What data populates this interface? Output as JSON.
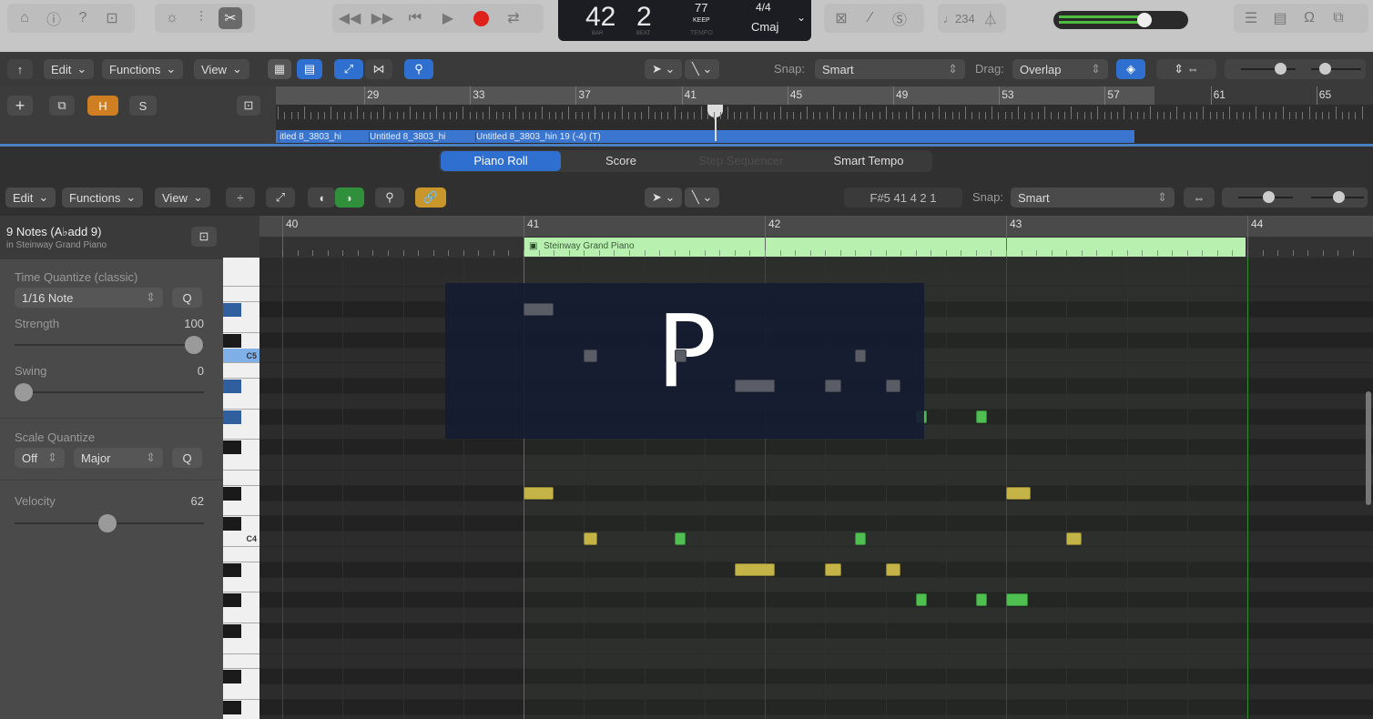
{
  "control_bar": {
    "lcd": {
      "bar": "42",
      "beat": "2",
      "bar_label": "BAR",
      "beat_label": "BEAT",
      "tempo": "77",
      "tempo_mode": "KEEP",
      "tempo_label": "TEMPO",
      "time_signature": "4/4",
      "key": "Cmaj"
    },
    "count_in": "♩234",
    "master_volume": 0.75,
    "icons": [
      "inbox-icon",
      "info-icon",
      "help-icon",
      "download-icon",
      "brightness-icon",
      "mixer-icon",
      "scissors-icon",
      "rewind-icon",
      "fast-forward-icon",
      "go-to-start-icon",
      "play-icon",
      "record-icon",
      "cycle-icon",
      "tuner-icon",
      "pencil-icon",
      "solo-icon",
      "metronome-icon",
      "list-icon",
      "note-pad-icon",
      "loops-icon",
      "browser-icon"
    ],
    "record_color": "#e0201a"
  },
  "tracks_toolbar": {
    "edit": "Edit",
    "functions": "Functions",
    "view": "View",
    "snap_label": "Snap:",
    "snap": "Smart",
    "drag_label": "Drag:",
    "drag": "Overlap"
  },
  "track_header": {
    "add": "+",
    "hide": "H",
    "solo": "S"
  },
  "tracks_ruler": {
    "bars": [
      "29",
      "33",
      "37",
      "41",
      "45",
      "49",
      "53",
      "57",
      "61",
      "65"
    ],
    "regions": [
      "itled 8_3803_hi",
      "Untitled 8_3803_hi",
      "Untitled 8_3803_hin 19 (-4)  (T)"
    ]
  },
  "editor_tabs": [
    {
      "label": "Piano Roll",
      "active": true
    },
    {
      "label": "Score",
      "active": false
    },
    {
      "label": "Step Sequencer",
      "active": false,
      "disabled": true
    },
    {
      "label": "Smart Tempo",
      "active": false
    }
  ],
  "editor_toolbar": {
    "edit": "Edit",
    "functions": "Functions",
    "view": "View",
    "position_info": "F#5  41 4 2 1",
    "snap_label": "Snap:",
    "snap": "Smart"
  },
  "inspector": {
    "title": "9 Notes (A♭add 9)",
    "subtitle": "in Steinway Grand Piano",
    "time_quantize_label": "Time Quantize (classic)",
    "time_quantize": "1/16 Note",
    "q": "Q",
    "strength_label": "Strength",
    "strength": "100",
    "swing_label": "Swing",
    "swing": "0",
    "scale_quantize_label": "Scale Quantize",
    "scale_root": "Off",
    "scale_type": "Major",
    "velocity_label": "Velocity",
    "velocity": "62"
  },
  "piano_roll": {
    "bars": [
      "40",
      "41",
      "42",
      "43",
      "44"
    ],
    "region_name": "Steinway Grand Piano",
    "region_color": "#b8f0b0",
    "key_labels": {
      "C5": "C5",
      "C4": "C4"
    },
    "highlighted_keys": [
      "D#5",
      "C5",
      "A#4",
      "G#4"
    ],
    "overlay_letter": "P",
    "note_colors": {
      "yellow": "#c4b448",
      "green": "#4fbf52",
      "ghost": "#5a5d66"
    },
    "notes": [
      {
        "pitch": "D#5",
        "start": 41.0,
        "length_beats": 0.5,
        "color": "ghost"
      },
      {
        "pitch": "C5",
        "start": 41.25,
        "length_beats": 0.22,
        "color": "ghost"
      },
      {
        "pitch": "C5",
        "start": 41.625,
        "length_beats": 0.2,
        "color": "ghost"
      },
      {
        "pitch": "A#4",
        "start": 41.875,
        "length_beats": 0.66,
        "color": "ghost"
      },
      {
        "pitch": "C5",
        "start": 42.375,
        "length_beats": 0.15,
        "color": "ghost"
      },
      {
        "pitch": "A#4",
        "start": 42.25,
        "length_beats": 0.27,
        "color": "ghost"
      },
      {
        "pitch": "A#4",
        "start": 42.5,
        "length_beats": 0.25,
        "color": "ghost"
      },
      {
        "pitch": "G#4",
        "start": 42.625,
        "length_beats": 0.18,
        "color": "green"
      },
      {
        "pitch": "G#4",
        "start": 42.875,
        "length_beats": 0.18,
        "color": "green"
      },
      {
        "pitch": "D#4",
        "start": 41.0,
        "length_beats": 0.5,
        "color": "yellow"
      },
      {
        "pitch": "D#4",
        "start": 43.0,
        "length_beats": 0.4,
        "color": "yellow"
      },
      {
        "pitch": "C4",
        "start": 41.25,
        "length_beats": 0.22,
        "color": "yellow"
      },
      {
        "pitch": "C4",
        "start": 41.625,
        "length_beats": 0.18,
        "color": "green"
      },
      {
        "pitch": "C4",
        "start": 42.375,
        "length_beats": 0.15,
        "color": "green"
      },
      {
        "pitch": "C4",
        "start": 43.25,
        "length_beats": 0.25,
        "color": "yellow"
      },
      {
        "pitch": "A#3",
        "start": 41.875,
        "length_beats": 0.66,
        "color": "yellow"
      },
      {
        "pitch": "A#3",
        "start": 42.25,
        "length_beats": 0.27,
        "color": "yellow"
      },
      {
        "pitch": "A#3",
        "start": 42.5,
        "length_beats": 0.25,
        "color": "yellow"
      },
      {
        "pitch": "G#3",
        "start": 42.625,
        "length_beats": 0.18,
        "color": "green"
      },
      {
        "pitch": "G#3",
        "start": 42.875,
        "length_beats": 0.18,
        "color": "green"
      },
      {
        "pitch": "G#3",
        "start": 43.0,
        "length_beats": 0.36,
        "color": "green"
      }
    ]
  }
}
